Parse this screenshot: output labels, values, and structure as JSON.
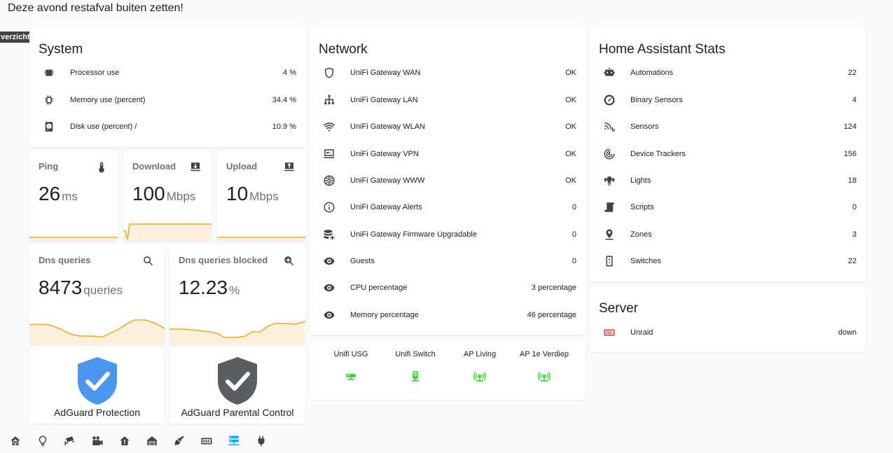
{
  "notice": "Deze avond restafval buiten zetten!",
  "overzicht_tag": "verzicht",
  "system": {
    "title": "System",
    "rows": [
      {
        "label": "Processor use",
        "value": "4 %",
        "icon": "processor-icon"
      },
      {
        "label": "Memory use (percent)",
        "value": "34.4 %",
        "icon": "memory-icon"
      },
      {
        "label": "Disk use (percent) /",
        "value": "10.9 %",
        "icon": "harddisk-icon"
      }
    ]
  },
  "ping": {
    "name": "Ping",
    "value": "26",
    "unit": "ms",
    "icon": "thermometer-icon"
  },
  "download": {
    "name": "Download",
    "value": "100",
    "unit": "Mbps",
    "icon": "download-icon"
  },
  "upload": {
    "name": "Upload",
    "value": "10",
    "unit": "Mbps",
    "icon": "upload-icon"
  },
  "dns": {
    "name": "Dns queries",
    "value": "8473",
    "unit": "queries",
    "icon": "magnify-icon"
  },
  "dns_blocked": {
    "name": "Dns queries blocked",
    "value": "12.23",
    "unit": "%",
    "icon": "magnify-plus-icon"
  },
  "adguard_protection": {
    "label": "AdGuard Protection",
    "color": "#4c95f0"
  },
  "adguard_parental": {
    "label": "AdGuard Parental Control",
    "color": "#5a5e63"
  },
  "network": {
    "title": "Network",
    "rows": [
      {
        "label": "UniFi Gateway WAN",
        "value": "OK",
        "icon": "shield-outline-icon"
      },
      {
        "label": "UniFi Gateway LAN",
        "value": "OK",
        "icon": "lan-icon"
      },
      {
        "label": "UniFi Gateway WLAN",
        "value": "OK",
        "icon": "wifi-icon"
      },
      {
        "label": "UniFi Gateway VPN",
        "value": "OK",
        "icon": "vpn-icon"
      },
      {
        "label": "UniFi Gateway WWW",
        "value": "OK",
        "icon": "web-icon"
      },
      {
        "label": "UniFi Gateway Alerts",
        "value": "0",
        "icon": "information-icon"
      },
      {
        "label": "UniFi Gateway Firmware Upgradable",
        "value": "0",
        "icon": "database-plus-icon"
      },
      {
        "label": "Guests",
        "value": "0",
        "icon": "eye-icon"
      },
      {
        "label": "CPU percentage",
        "value": "3 percentage",
        "icon": "eye-icon"
      },
      {
        "label": "Memory percentage",
        "value": "46 percentage",
        "icon": "eye-icon"
      }
    ]
  },
  "devices": [
    {
      "label": "Unifi USG",
      "icon": "router-icon"
    },
    {
      "label": "Unifi Switch",
      "icon": "switch-icon"
    },
    {
      "label": "AP Living",
      "icon": "access-point-icon"
    },
    {
      "label": "AP 1e Verdiep",
      "icon": "access-point-icon"
    }
  ],
  "device_color": "#22d922",
  "ha_stats": {
    "title": "Home Assistant Stats",
    "rows": [
      {
        "label": "Automations",
        "value": "22",
        "icon": "robot-icon"
      },
      {
        "label": "Binary Sensors",
        "value": "4",
        "icon": "gauge-icon"
      },
      {
        "label": "Sensors",
        "value": "124",
        "icon": "signal-icon"
      },
      {
        "label": "Device Trackers",
        "value": "156",
        "icon": "radar-icon"
      },
      {
        "label": "Lights",
        "value": "18",
        "icon": "lightbulb-group-icon"
      },
      {
        "label": "Scripts",
        "value": "0",
        "icon": "script-icon"
      },
      {
        "label": "Zones",
        "value": "3",
        "icon": "map-marker-icon"
      },
      {
        "label": "Switches",
        "value": "22",
        "icon": "light-switch-icon"
      }
    ]
  },
  "server": {
    "title": "Server",
    "rows": [
      {
        "label": "Unraid",
        "value": "down",
        "icon": "server-red-icon"
      }
    ]
  },
  "nav": [
    "home-icon",
    "lightbulb-icon",
    "cctv-icon",
    "camera-icon",
    "home-alert-icon",
    "home-garage-icon",
    "broom-icon",
    "memory-chip-icon",
    "server-network-icon",
    "power-plug-icon"
  ],
  "nav_active_index": 8,
  "accent_color": "#03a9f4"
}
